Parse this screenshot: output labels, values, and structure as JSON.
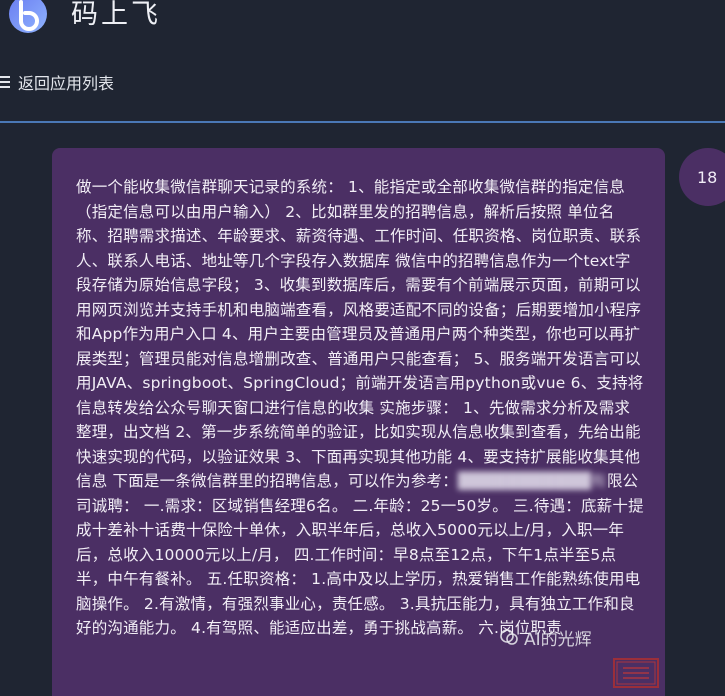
{
  "app": {
    "title": "码上飞"
  },
  "nav": {
    "back_label": "返回应用列表"
  },
  "conversation": {
    "avatar_label": "18",
    "message_before_redaction": "做一个能收集微信群聊天记录的系统： 1、能指定或全部收集微信群的指定信息（指定信息可以由用户输入） 2、比如群里发的招聘信息，解析后按照 单位名称、招聘需求描述、年龄要求、薪资待遇、工作时间、任职资格、岗位职责、联系人、联系人电话、地址等几个字段存入数据库 微信中的招聘信息作为一个text字段存储为原始信息字段； 3、收集到数据库后，需要有个前端展示页面，前期可以用网页浏览并支持手机和电脑端查看，风格要适配不同的设备；后期要增加小程序和App作为用户入口 4、用户主要由管理员及普通用户两个种类型，你也可以再扩展类型；管理员能对信息增删改查、普通用户只能查看； 5、服务端开发语言可以用JAVA、springboot、SpringCloud；前端开发语言用python或vue 6、支持将信息转发给公众号聊天窗口进行信息的收集 实施步骤： 1、先做需求分析及需求整理，出文档 2、第一步系统简单的验证，比如实现从信息收集到查看，先给出能快速实现的代码，以验证效果 3、下面再实现其他功能 4、要支持扩展能收集其他信息 下面是一条微信群里的招聘信息，可以作为参考：",
    "message_redacted": "███████████有",
    "message_after_redaction": "限公司诚聘： 一.需求：区域销售经理6名。 二.年龄：25一50岁。 三.待遇：底薪十提成十差补十话费十保险十单休，入职半年后，总收入5000元以上/月，入职一年后，总收入10000元以上/月， 四.工作时间：早8点至12点，下午1点半至5点半，中午有餐补。 五.任职资格： 1.高中及以上学历，热爱销售工作能熟练使用电脑操作。 2.有激情，有强烈事业心，责任感。 3.具抗压能力，具有独立工作和良好的沟通能力。 4.有驾照、能适应出差，勇于挑战高薪。 六.岗位职责"
  },
  "watermark": {
    "text": "AI的光辉"
  },
  "colors": {
    "background": "#1f2532",
    "bubble": "#4b2f64",
    "divider": "#4a78b6",
    "text": "#f2eef6"
  }
}
